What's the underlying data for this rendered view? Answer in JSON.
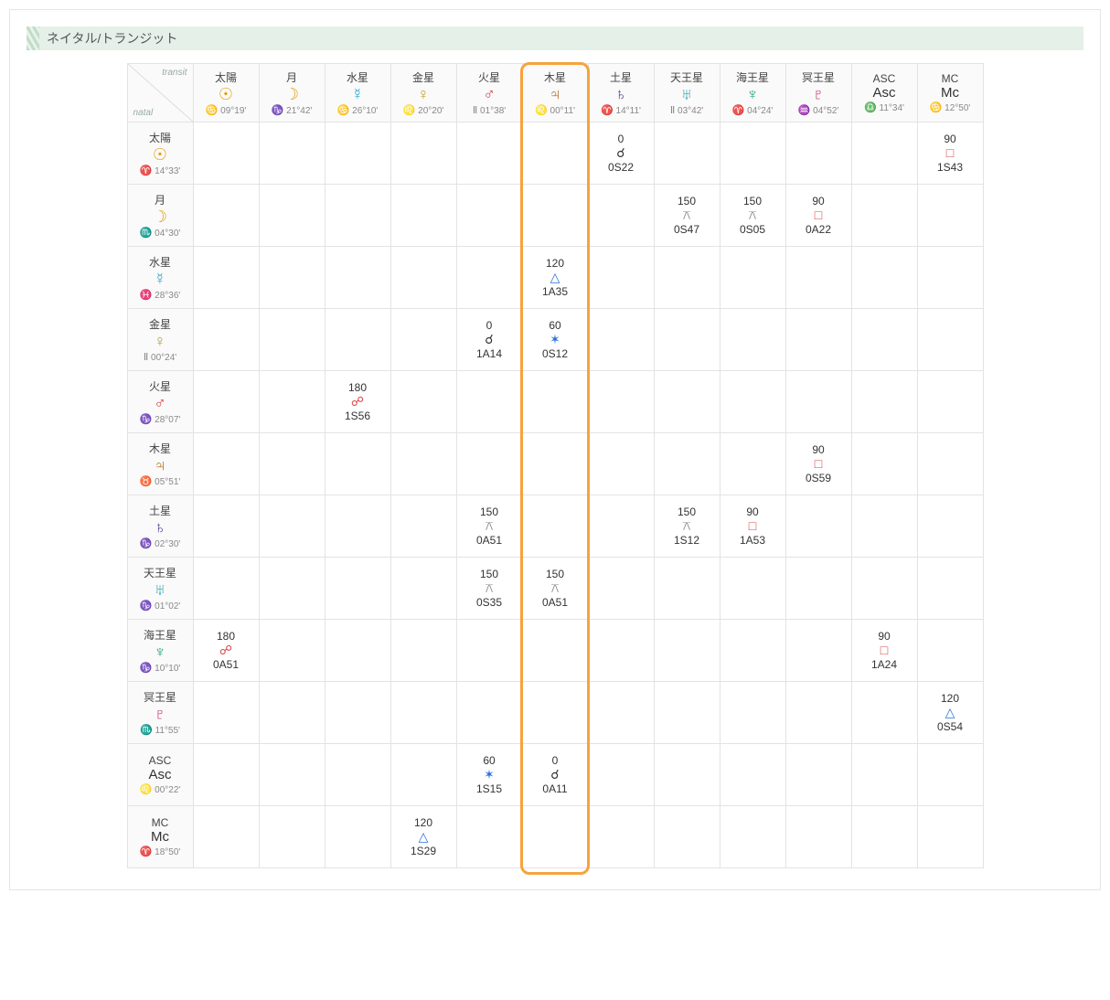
{
  "title": "ネイタル/トランジット",
  "corner": {
    "transit": "transit",
    "natal": "natal"
  },
  "planets": [
    {
      "key": "sun",
      "name": "太陽",
      "glyph": "☉",
      "cls": "sun"
    },
    {
      "key": "moon",
      "name": "月",
      "glyph": "☽",
      "cls": "moon"
    },
    {
      "key": "mercury",
      "name": "水星",
      "glyph": "☿",
      "cls": "mercury"
    },
    {
      "key": "venus",
      "name": "金星",
      "glyph": "♀",
      "cls": "venus"
    },
    {
      "key": "mars",
      "name": "火星",
      "glyph": "♂",
      "cls": "mars"
    },
    {
      "key": "jupiter",
      "name": "木星",
      "glyph": "♃",
      "cls": "jupiter"
    },
    {
      "key": "saturn",
      "name": "土星",
      "glyph": "♄",
      "cls": "saturn"
    },
    {
      "key": "uranus",
      "name": "天王星",
      "glyph": "♅",
      "cls": "uranus"
    },
    {
      "key": "neptune",
      "name": "海王星",
      "glyph": "♆",
      "cls": "neptune"
    },
    {
      "key": "pluto",
      "name": "冥王星",
      "glyph": "♇",
      "cls": "pluto"
    },
    {
      "key": "asc",
      "name": "ASC",
      "glyph": "Asc",
      "cls": "asc",
      "small": true
    },
    {
      "key": "mc",
      "name": "MC",
      "glyph": "Mc",
      "cls": "mc",
      "small": true
    }
  ],
  "transit_pos": {
    "sun": {
      "sign": "♋",
      "deg": "09°19'"
    },
    "moon": {
      "sign": "♑",
      "deg": "21°42'"
    },
    "mercury": {
      "sign": "♋",
      "deg": "26°10'"
    },
    "venus": {
      "sign": "♌",
      "deg": "20°20'"
    },
    "mars": {
      "sign": "Ⅱ",
      "deg": "01°38'"
    },
    "jupiter": {
      "sign": "♌",
      "deg": "00°11'"
    },
    "saturn": {
      "sign": "♈",
      "deg": "14°11'"
    },
    "uranus": {
      "sign": "Ⅱ",
      "deg": "03°42'"
    },
    "neptune": {
      "sign": "♈",
      "deg": "04°24'"
    },
    "pluto": {
      "sign": "♒",
      "deg": "04°52'"
    },
    "asc": {
      "sign": "♎",
      "deg": "11°34'"
    },
    "mc": {
      "sign": "♋",
      "deg": "12°50'"
    }
  },
  "natal_pos": {
    "sun": {
      "sign": "♈",
      "deg": "14°33'"
    },
    "moon": {
      "sign": "♏",
      "deg": "04°30'"
    },
    "mercury": {
      "sign": "♓",
      "deg": "28°36'"
    },
    "venus": {
      "sign": "Ⅱ",
      "deg": "00°24'"
    },
    "mars": {
      "sign": "♑",
      "deg": "28°07'"
    },
    "jupiter": {
      "sign": "♉",
      "deg": "05°51'"
    },
    "saturn": {
      "sign": "♑",
      "deg": "02°30'"
    },
    "uranus": {
      "sign": "♑",
      "deg": "01°02'"
    },
    "neptune": {
      "sign": "♑",
      "deg": "10°10'"
    },
    "pluto": {
      "sign": "♏",
      "deg": "11°55'"
    },
    "asc": {
      "sign": "♌",
      "deg": "00°22'"
    },
    "mc": {
      "sign": "♈",
      "deg": "18°50'"
    }
  },
  "aspect_glyph": {
    "conj": "☌",
    "opp": "☍",
    "sq": "□",
    "tri": "△",
    "sex": "✶",
    "qui": "⚻"
  },
  "grid": {
    "sun": {
      "saturn": {
        "deg": "0",
        "asp": "conj",
        "orb": "0S22"
      },
      "mc": {
        "deg": "90",
        "asp": "sq",
        "orb": "1S43"
      }
    },
    "moon": {
      "uranus": {
        "deg": "150",
        "asp": "qui",
        "orb": "0S47"
      },
      "neptune": {
        "deg": "150",
        "asp": "qui",
        "orb": "0S05"
      },
      "pluto": {
        "deg": "90",
        "asp": "sq",
        "orb": "0A22"
      }
    },
    "mercury": {
      "jupiter": {
        "deg": "120",
        "asp": "tri",
        "orb": "1A35"
      }
    },
    "venus": {
      "mars": {
        "deg": "0",
        "asp": "conj",
        "orb": "1A14"
      },
      "jupiter": {
        "deg": "60",
        "asp": "sex",
        "orb": "0S12"
      }
    },
    "mars": {
      "mercury": {
        "deg": "180",
        "asp": "opp",
        "orb": "1S56"
      }
    },
    "jupiter": {
      "pluto": {
        "deg": "90",
        "asp": "sq",
        "orb": "0S59"
      }
    },
    "saturn": {
      "mars": {
        "deg": "150",
        "asp": "qui",
        "orb": "0A51"
      },
      "uranus": {
        "deg": "150",
        "asp": "qui",
        "orb": "1S12"
      },
      "neptune": {
        "deg": "90",
        "asp": "sq",
        "orb": "1A53"
      }
    },
    "uranus": {
      "mars": {
        "deg": "150",
        "asp": "qui",
        "orb": "0S35"
      },
      "jupiter": {
        "deg": "150",
        "asp": "qui",
        "orb": "0A51"
      }
    },
    "neptune": {
      "sun": {
        "deg": "180",
        "asp": "opp",
        "orb": "0A51"
      },
      "asc": {
        "deg": "90",
        "asp": "sq",
        "orb": "1A24"
      }
    },
    "pluto": {
      "mc": {
        "deg": "120",
        "asp": "tri",
        "orb": "0S54"
      }
    },
    "asc": {
      "mars": {
        "deg": "60",
        "asp": "sex",
        "orb": "1S15"
      },
      "jupiter": {
        "deg": "0",
        "asp": "conj",
        "orb": "0A11"
      }
    },
    "mc": {
      "venus": {
        "deg": "120",
        "asp": "tri",
        "orb": "1S29"
      }
    }
  },
  "highlight_col": "jupiter",
  "chart_data": {
    "type": "table",
    "title": "ネイタル/トランジット",
    "columns_label": "transit",
    "rows_label": "natal",
    "transit_positions": {
      "太陽": "♋ 09°19'",
      "月": "♑ 21°42'",
      "水星": "♋ 26°10'",
      "金星": "♌ 20°20'",
      "火星": "Ⅱ 01°38'",
      "木星": "♌ 00°11'",
      "土星": "♈ 14°11'",
      "天王星": "Ⅱ 03°42'",
      "海王星": "♈ 04°24'",
      "冥王星": "♒ 04°52'",
      "ASC": "♎ 11°34'",
      "MC": "♋ 12°50'"
    },
    "natal_positions": {
      "太陽": "♈ 14°33'",
      "月": "♏ 04°30'",
      "水星": "♓ 28°36'",
      "金星": "Ⅱ 00°24'",
      "火星": "♑ 28°07'",
      "木星": "♉ 05°51'",
      "土星": "♑ 02°30'",
      "天王星": "♑ 01°02'",
      "海王星": "♑ 10°10'",
      "冥王星": "♏ 11°55'",
      "ASC": "♌ 00°22'",
      "MC": "♈ 18°50'"
    },
    "aspects": [
      {
        "natal": "太陽",
        "transit": "土星",
        "angle": 0,
        "aspect": "conjunction",
        "orb": "0S22"
      },
      {
        "natal": "太陽",
        "transit": "MC",
        "angle": 90,
        "aspect": "square",
        "orb": "1S43"
      },
      {
        "natal": "月",
        "transit": "天王星",
        "angle": 150,
        "aspect": "quincunx",
        "orb": "0S47"
      },
      {
        "natal": "月",
        "transit": "海王星",
        "angle": 150,
        "aspect": "quincunx",
        "orb": "0S05"
      },
      {
        "natal": "月",
        "transit": "冥王星",
        "angle": 90,
        "aspect": "square",
        "orb": "0A22"
      },
      {
        "natal": "水星",
        "transit": "木星",
        "angle": 120,
        "aspect": "trine",
        "orb": "1A35"
      },
      {
        "natal": "金星",
        "transit": "火星",
        "angle": 0,
        "aspect": "conjunction",
        "orb": "1A14"
      },
      {
        "natal": "金星",
        "transit": "木星",
        "angle": 60,
        "aspect": "sextile",
        "orb": "0S12"
      },
      {
        "natal": "火星",
        "transit": "水星",
        "angle": 180,
        "aspect": "opposition",
        "orb": "1S56"
      },
      {
        "natal": "木星",
        "transit": "冥王星",
        "angle": 90,
        "aspect": "square",
        "orb": "0S59"
      },
      {
        "natal": "土星",
        "transit": "火星",
        "angle": 150,
        "aspect": "quincunx",
        "orb": "0A51"
      },
      {
        "natal": "土星",
        "transit": "天王星",
        "angle": 150,
        "aspect": "quincunx",
        "orb": "1S12"
      },
      {
        "natal": "土星",
        "transit": "海王星",
        "angle": 90,
        "aspect": "square",
        "orb": "1A53"
      },
      {
        "natal": "天王星",
        "transit": "火星",
        "angle": 150,
        "aspect": "quincunx",
        "orb": "0S35"
      },
      {
        "natal": "天王星",
        "transit": "木星",
        "angle": 150,
        "aspect": "quincunx",
        "orb": "0A51"
      },
      {
        "natal": "海王星",
        "transit": "太陽",
        "angle": 180,
        "aspect": "opposition",
        "orb": "0A51"
      },
      {
        "natal": "海王星",
        "transit": "ASC",
        "angle": 90,
        "aspect": "square",
        "orb": "1A24"
      },
      {
        "natal": "冥王星",
        "transit": "MC",
        "angle": 120,
        "aspect": "trine",
        "orb": "0S54"
      },
      {
        "natal": "ASC",
        "transit": "火星",
        "angle": 60,
        "aspect": "sextile",
        "orb": "1S15"
      },
      {
        "natal": "ASC",
        "transit": "木星",
        "angle": 0,
        "aspect": "conjunction",
        "orb": "0A11"
      },
      {
        "natal": "MC",
        "transit": "金星",
        "angle": 120,
        "aspect": "trine",
        "orb": "1S29"
      }
    ],
    "highlighted_transit_column": "木星"
  }
}
